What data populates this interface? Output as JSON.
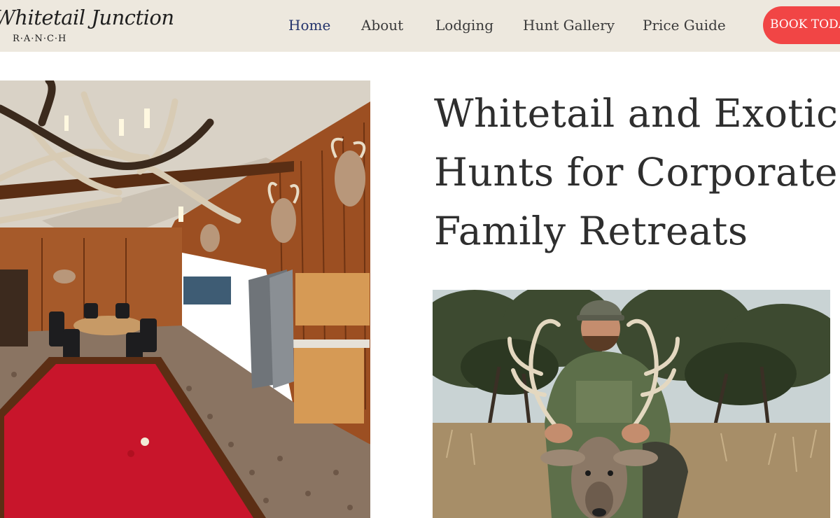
{
  "header": {
    "logo": {
      "script_text": "Whitetail Junction",
      "sub_text": "R·A·N·C·H"
    },
    "nav": [
      {
        "label": "Home",
        "active": true
      },
      {
        "label": "About",
        "active": false
      },
      {
        "label": "Lodging",
        "active": false
      },
      {
        "label": "Hunt Gallery",
        "active": false
      },
      {
        "label": "Price Guide",
        "active": false
      }
    ],
    "book_button_label": "BOOK TODAY"
  },
  "hero": {
    "title_lines": [
      "Whitetail and Exotic",
      "Hunts for Corporate",
      "Family Retreats"
    ]
  },
  "images": {
    "left_photo": "lodge-game-room-photo",
    "right_photo": "hunter-with-whitetail-buck-photo"
  },
  "colors": {
    "header_bg": "#ede8de",
    "nav_active": "#23336b",
    "nav_text": "#3a3a3a",
    "book_button_bg": "#f14545",
    "title_text": "#2e2e2e"
  }
}
